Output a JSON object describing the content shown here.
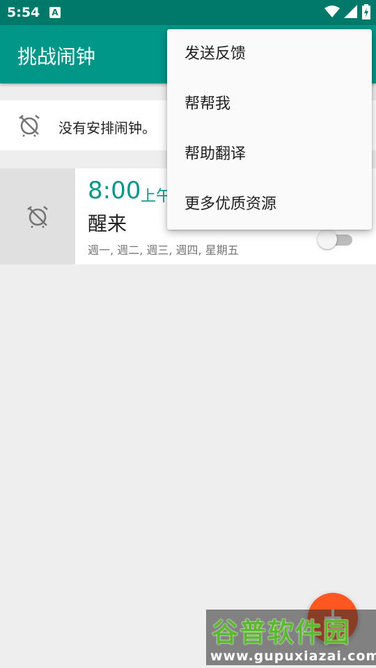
{
  "status_bar": {
    "time": "5:54",
    "notification_icon": "A",
    "icons": [
      "wifi-icon",
      "cellular-signal-icon",
      "battery-charging-icon"
    ]
  },
  "app_bar": {
    "title": "挑战闹钟",
    "color": "#009688"
  },
  "banner": {
    "icon": "alarm-off-icon",
    "text": "没有安排闹钟。"
  },
  "alarm": {
    "icon": "alarm-off-icon",
    "time": "8:00",
    "ampm": "上午",
    "label": "醒来",
    "days": "週一, 週二, 週三, 週四, 星期五",
    "enabled": false
  },
  "overflow_menu": {
    "items": [
      {
        "label": "发送反馈"
      },
      {
        "label": "帮帮我"
      },
      {
        "label": "帮助翻译"
      },
      {
        "label": "更多优质资源"
      }
    ]
  },
  "fab": {
    "icon": "add-icon",
    "color": "#ff5722"
  },
  "watermark": {
    "brand": "谷普软件园",
    "url": "www.gupuxiazai.com"
  }
}
